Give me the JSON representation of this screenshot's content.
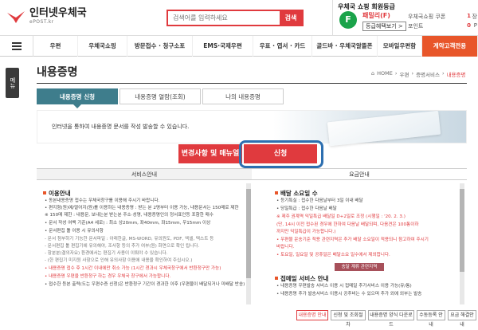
{
  "header": {
    "logo_title": "인터넷우체국",
    "logo_sub": "ePOST.kr",
    "search_placeholder": "검색어를 입력하세요",
    "search_button": "검색",
    "member": {
      "title": "우체국 쇼핑 회원등급",
      "grade_letter": "F",
      "grade_name": "패밀리(F)",
      "grade_button": "등급혜택보기 >",
      "coupon_label": "우체국쇼핑 쿠폰",
      "coupon_value": "1",
      "coupon_unit": "장",
      "point_label": "포인트",
      "point_value": "0",
      "point_unit": "P"
    }
  },
  "nav": {
    "items": [
      "우편",
      "우체국쇼핑",
      "방문접수 · 청구소포",
      "EMS·국제우편",
      "우표 · 엽서 · 카드",
      "골드바 · 우체국알뜰폰",
      "모바일우편함",
      "계약고객전용"
    ]
  },
  "side_tab": "메뉴",
  "page": {
    "title": "내용증명",
    "breadcrumb": [
      "HOME",
      "우편",
      "증명서비스",
      "내용증명"
    ]
  },
  "tabs": [
    "내용증명 신청",
    "내용증명 열람(조회)",
    "나의 내용증명"
  ],
  "banner": {
    "text": "인터넷을 통하여 내용증명 문서를 작성 발송할 수 있습니다."
  },
  "buttons": {
    "change": "변경사항 및 매뉴얼",
    "apply": "신청"
  },
  "columns": {
    "left_header": "서비스안내",
    "right_header": "요금안내"
  },
  "left": {
    "section1": "이용안내",
    "lines": [
      "• 동본내용증명 접수는 우체국창구를 이용해 주시기 바랍니다.",
      "• 편지형(원)예/열어지(원)를 이용하는 내용증명 : 받는 분 2명부터 이용 가능, 내용문서는 150매로 제한",
      "  ※ 150매 제한 : 내용문, 보내는분 받는분 주소·성명, 내용증명인의 정서표인등 포함한 매수",
      "• 문서 작성 여백 기준(A4 세로) : 최소 상20mm, 좌40mm, 좌15mm, 우15mm 이상",
      "• 문서편집 툴 이용 시 유의사항",
      "  - 문서 첨부하기 기능한 문서파일 : 아래한글, MS-WORD, 유의원도, PDF, 엑셀, 텍스트 등",
      "  - 문서편집 툴 편집기에 유의해야, 조사항 등의 추가 여부(원) 화면으로 확인 됩니다.",
      "  - 항분분(결의자요) 환경에서는 편집기 사용이 이뤄야 수 있습니다.",
      "  - (한 편집기 미지원 사항으로 인해 유의사항 이용에 내용을 확인하여 주십시오.)",
      "• 내용증명 접수 후 1시간 이내에만 취소 가능 (1시간 경과시 우체국창구에서 반환청구만 가능)",
      "• 내용증명 우편을 반환청구 하는 경우 우체국 창구에서 가능합니다.",
      "• 접수한 등본 출력(도는 우편수증 신청)은 반환청구 기간이 경과한 이후 (우편물이 배달되거나 미배달 반송)"
    ]
  },
  "right": {
    "section1": "배달 소요일 수",
    "lines1": [
      "• 등기특실 : 접수한 다음날부터 3일 이내 배달",
      "• 당일특급 : 접수한 다음날 배달",
      "  ※ 제주 권계역 익일특급 배달일 D+2일로 조정 (시행일 : '20. 2. 3.)",
      "  (단, 14시 이전 접수된 경우에 한하여 다음날 배달되며, 다음견은 100통이하",
      "  까지만 익일특급이 가능합니다.)",
      "• 우편물 운송기준 적용 관련지역은 추가 배달 소요일이 적용되니 참고하여 주시기",
      "  바랍니다.",
      "• 토요일, 일요일 및 공휴일은 배달소요 일수에서 제외합니다."
    ],
    "small_button": "송달 계류 관련지역",
    "section2": "접메일 서비스 안내",
    "lines2": [
      "• 내용증명 우편발송 서비스 이용 시 접메일 추가서비스 이용 가능(유/통)",
      "• 내용증명 추가 발송서비스 이용시 공추비는 수 있으며 추가 외에 외부는 발송"
    ]
  },
  "bottom_buttons": [
    "내용증명 안내",
    "신청 및 조회절차",
    "내용증명 양식 다운로드",
    "수동등록 안내",
    "요금 해결안내"
  ]
}
